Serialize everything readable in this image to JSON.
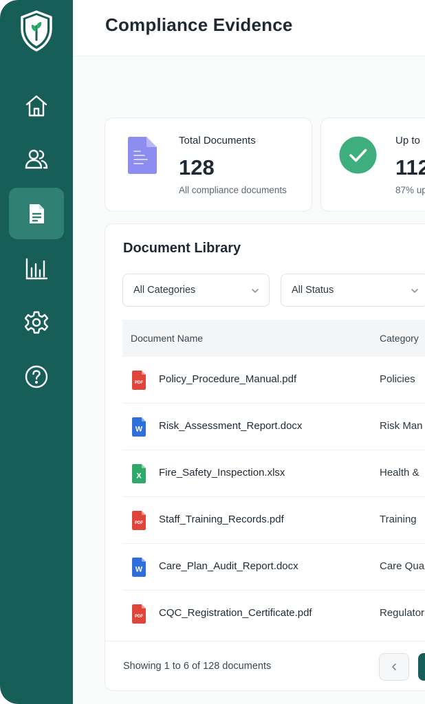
{
  "header": {
    "title": "Compliance Evidence"
  },
  "sidebar": {
    "items": [
      {
        "name": "home",
        "icon": "home-icon",
        "active": false
      },
      {
        "name": "users",
        "icon": "users-icon",
        "active": false
      },
      {
        "name": "documents",
        "icon": "document-icon",
        "active": true
      },
      {
        "name": "reports",
        "icon": "bar-chart-icon",
        "active": false
      },
      {
        "name": "settings",
        "icon": "gear-icon",
        "active": false
      },
      {
        "name": "help",
        "icon": "help-icon",
        "active": false
      }
    ]
  },
  "stats": [
    {
      "title": "Total Documents",
      "value": "128",
      "subtitle": "All compliance documents",
      "icon": "document-icon"
    },
    {
      "title": "Up to",
      "value": "112",
      "subtitle": "87% up",
      "icon": "check-circle-icon"
    }
  ],
  "library": {
    "title": "Document Library",
    "filters": {
      "category": "All Categories",
      "status": "All Status"
    },
    "columns": {
      "name": "Document Name",
      "category": "Category"
    },
    "rows": [
      {
        "name": "Policy_Procedure_Manual.pdf",
        "category": "Policies",
        "type": "pdf"
      },
      {
        "name": "Risk_Assessment_Report.docx",
        "category": "Risk Man",
        "type": "docx"
      },
      {
        "name": "Fire_Safety_Inspection.xlsx",
        "category": "Health &",
        "type": "xlsx"
      },
      {
        "name": "Staff_Training_Records.pdf",
        "category": "Training",
        "type": "pdf"
      },
      {
        "name": "Care_Plan_Audit_Report.docx",
        "category": "Care Qua",
        "type": "docx"
      },
      {
        "name": "CQC_Registration_Certificate.pdf",
        "category": "Regulator",
        "type": "pdf"
      }
    ],
    "footer": {
      "showing": "Showing 1 to 6 of 128 documents"
    }
  },
  "colors": {
    "sidebar": "#175e59",
    "active": "#2f8073",
    "pdf": "#e0453c",
    "docx": "#2f6fdb",
    "xlsx": "#2fa86b",
    "success": "#3fae7f",
    "doc_icon": "#8d8cf0"
  }
}
